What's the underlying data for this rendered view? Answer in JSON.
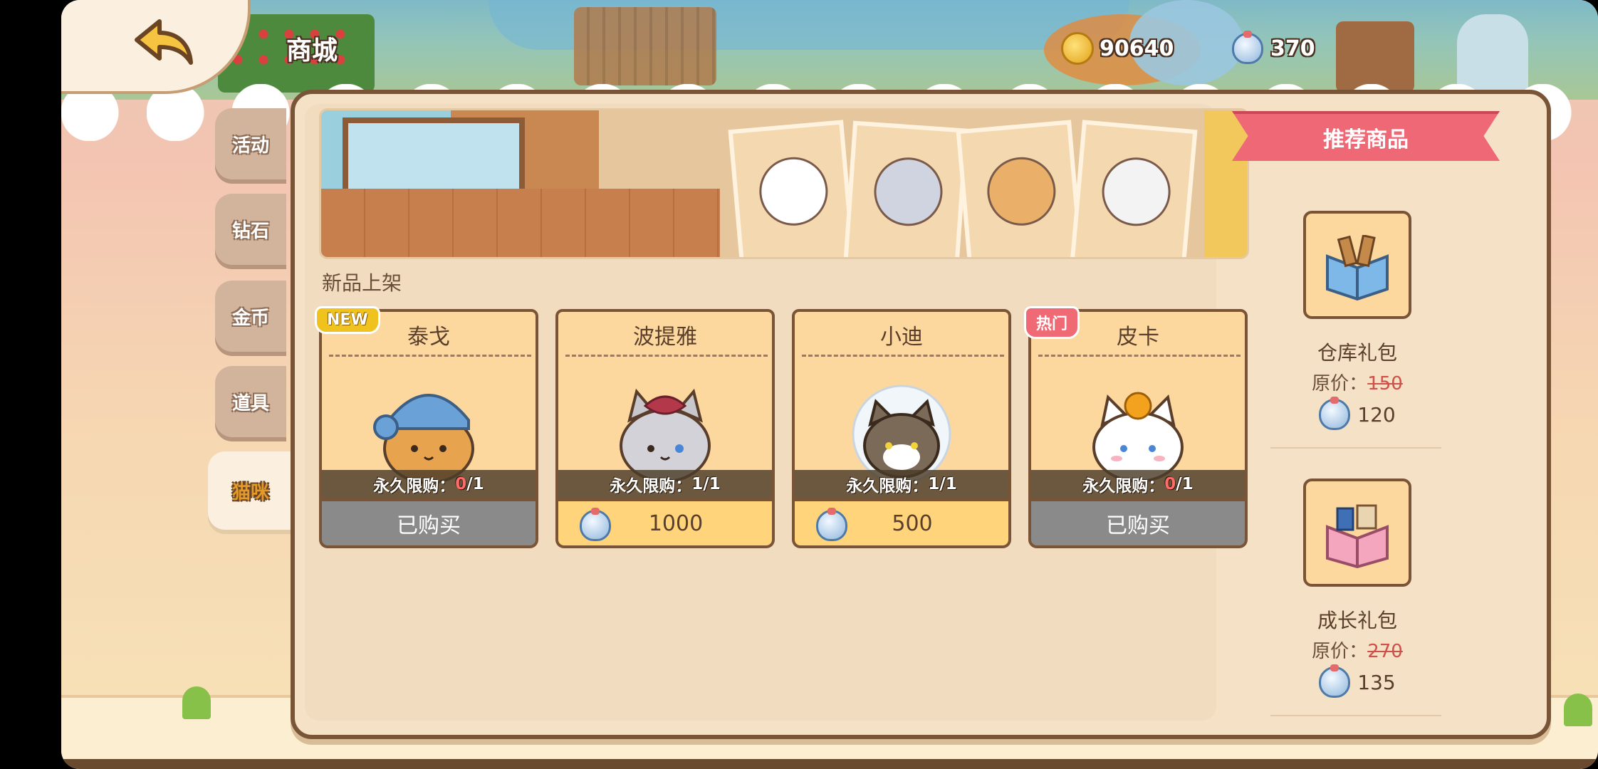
{
  "header": {
    "title": "商城"
  },
  "currency": {
    "coins": "90640",
    "bells": "370"
  },
  "side_tabs": [
    {
      "label": "活动"
    },
    {
      "label": "钻石"
    },
    {
      "label": "金币"
    },
    {
      "label": "道具"
    },
    {
      "label": "猫咪",
      "active": true
    }
  ],
  "section": {
    "label": "新品上架"
  },
  "cards": [
    {
      "name": "泰戈",
      "badge": "NEW",
      "limit_prefix": "永久限购：",
      "limit_count": "0",
      "limit_total": "/1",
      "button": "已购买",
      "state": "bought",
      "fur": "#e8a34e"
    },
    {
      "name": "波提雅",
      "badge": "",
      "limit_prefix": "永久限购：",
      "limit_count": "1",
      "limit_total": "/1",
      "price": "1000",
      "state": "buy",
      "fur": "#c8c8cc"
    },
    {
      "name": "小迪",
      "badge": "",
      "limit_prefix": "永久限购：",
      "limit_count": "1",
      "limit_total": "/1",
      "price": "500",
      "state": "buy",
      "fur": "#7b6a58"
    },
    {
      "name": "皮卡",
      "badge": "热门",
      "limit_prefix": "永久限购：",
      "limit_count": "0",
      "limit_total": "/1",
      "button": "已购买",
      "state": "bought",
      "fur": "#ffffff"
    }
  ],
  "recommended": {
    "title": "推荐商品",
    "gifts": [
      {
        "name": "仓库礼包",
        "orig_label": "原价：",
        "orig_price": "150",
        "price": "120",
        "box_color": "#7db8e8"
      },
      {
        "name": "成长礼包",
        "orig_label": "原价：",
        "orig_price": "270",
        "price": "135",
        "box_color": "#f4a6bf"
      }
    ]
  },
  "colors": {
    "panel_border": "#7a5436",
    "card_bg": "#fdd89e",
    "ribbon": "#ef6876",
    "bought": "#8a8a8a"
  }
}
